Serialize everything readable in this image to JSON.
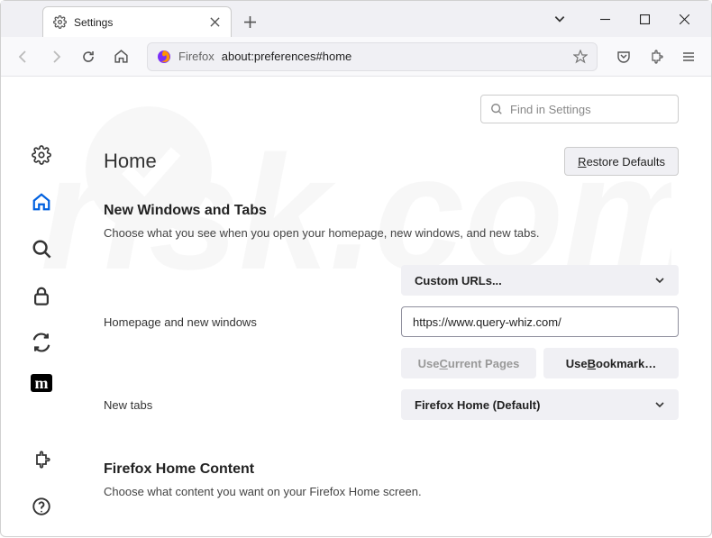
{
  "window": {
    "tab_title": "Settings",
    "url_protocol": "Firefox",
    "url_path": "about:preferences#home"
  },
  "search": {
    "placeholder": "Find in Settings"
  },
  "page": {
    "title": "Home",
    "restore_defaults": "Restore Defaults"
  },
  "section1": {
    "title": "New Windows and Tabs",
    "desc": "Choose what you see when you open your homepage, new windows, and new tabs.",
    "homepage_label": "Homepage and new windows",
    "homepage_select": "Custom URLs...",
    "homepage_value": "https://www.query-whiz.com/",
    "use_current": "Use Current Pages",
    "use_bookmark": "Use Bookmark…",
    "newtabs_label": "New tabs",
    "newtabs_select": "Firefox Home (Default)"
  },
  "section2": {
    "title": "Firefox Home Content",
    "desc": "Choose what content you want on your Firefox Home screen."
  }
}
